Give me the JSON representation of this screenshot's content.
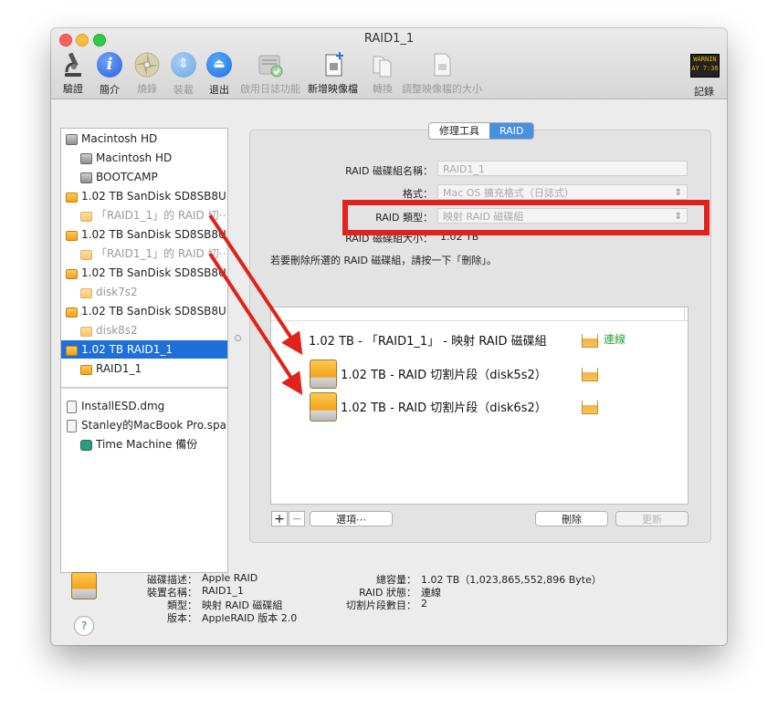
{
  "window": {
    "title": "RAID1_1"
  },
  "toolbar": {
    "items": [
      {
        "label": "驗證",
        "icon": "microscope-icon",
        "enabled": true
      },
      {
        "label": "簡介",
        "icon": "info-icon",
        "enabled": true
      },
      {
        "label": "燒錄",
        "icon": "burn-disc-icon",
        "enabled": false
      },
      {
        "label": "裝載",
        "icon": "mount-icon",
        "enabled": false
      },
      {
        "label": "退出",
        "icon": "eject-icon",
        "enabled": true
      },
      {
        "label": "啟用日誌功能",
        "icon": "journal-icon",
        "enabled": false
      },
      {
        "label": "新增映像檔",
        "icon": "new-image-icon",
        "enabled": true
      },
      {
        "label": "轉換",
        "icon": "convert-icon",
        "enabled": false
      },
      {
        "label": "調整映像檔的大小",
        "icon": "resize-image-icon",
        "enabled": false
      }
    ],
    "log": {
      "label": "記錄",
      "icon": "log-icon",
      "badge": "WARNIN\nAY 7:36"
    }
  },
  "sidebar": {
    "items": [
      {
        "label": "Macintosh HD",
        "icon": "hard-drive-icon",
        "level": 0,
        "dim": false,
        "selected": false
      },
      {
        "label": "Macintosh HD",
        "icon": "hard-drive-icon",
        "level": 1,
        "dim": false,
        "selected": false
      },
      {
        "label": "BOOTCAMP",
        "icon": "hard-drive-icon",
        "level": 1,
        "dim": false,
        "selected": false
      },
      {
        "label": "1.02 TB SanDisk SD8SB8U...",
        "icon": "external-drive-icon",
        "level": 0,
        "dim": false,
        "selected": false
      },
      {
        "label": "「RAID1_1」的 RAID 切⋯",
        "icon": "external-drive-icon",
        "level": 1,
        "dim": true,
        "selected": false
      },
      {
        "label": "1.02 TB SanDisk SD8SB8U...",
        "icon": "external-drive-icon",
        "level": 0,
        "dim": false,
        "selected": false
      },
      {
        "label": "「RAID1_1」的 RAID 切⋯",
        "icon": "external-drive-icon",
        "level": 1,
        "dim": true,
        "selected": false
      },
      {
        "label": "1.02 TB SanDisk SD8SB8U...",
        "icon": "external-drive-icon",
        "level": 0,
        "dim": false,
        "selected": false
      },
      {
        "label": "disk7s2",
        "icon": "external-drive-icon",
        "level": 1,
        "dim": true,
        "selected": false
      },
      {
        "label": "1.02 TB SanDisk SD8SB8U...",
        "icon": "external-drive-icon",
        "level": 0,
        "dim": false,
        "selected": false
      },
      {
        "label": "disk8s2",
        "icon": "external-drive-icon",
        "level": 1,
        "dim": true,
        "selected": false
      },
      {
        "label": "1.02 TB RAID1_1",
        "icon": "external-drive-icon",
        "level": 0,
        "dim": false,
        "selected": true
      },
      {
        "label": "RAID1_1",
        "icon": "external-drive-icon",
        "level": 1,
        "dim": false,
        "selected": false
      }
    ],
    "images": [
      {
        "label": "InstallESD.dmg",
        "icon": "disk-image-icon",
        "level": 0
      },
      {
        "label": "Stanley的MacBook Pro.spa...",
        "icon": "disk-image-icon",
        "level": 0
      },
      {
        "label": "Time Machine 備份",
        "icon": "time-machine-icon",
        "level": 1
      }
    ]
  },
  "tabs": {
    "repair": "修理工具",
    "raid": "RAID"
  },
  "raid_form": {
    "name_label": "RAID 磁碟組名稱：",
    "name_value": "RAID1_1",
    "format_label": "格式：",
    "format_value": "Mac OS 擴充格式（日誌式）",
    "type_label": "RAID 類型：",
    "type_value": "映射 RAID 磁碟組",
    "size_label": "RAID 磁碟組大小：",
    "size_value": "1.02 TB",
    "note": "若要刪除所選的 RAID 磁碟組，請按一下「刪除」。"
  },
  "raid_list": {
    "set": {
      "label": "1.02 TB - 「RAID1_1」 - 映射 RAID 磁碟組",
      "status": "連線"
    },
    "members": [
      {
        "label": "1.02 TB - RAID 切割片段（disk5s2）"
      },
      {
        "label": "1.02 TB - RAID 切割片段（disk6s2）"
      }
    ]
  },
  "buttons": {
    "add": "+",
    "remove": "−",
    "options": "選項⋯",
    "delete": "刪除",
    "update": "更新"
  },
  "info": {
    "desc_label": "磁碟描述：",
    "desc_value": "Apple RAID",
    "device_label": "裝置名稱：",
    "device_value": "RAID1_1",
    "type_label": "類型：",
    "type_value": "映射 RAID 磁碟組",
    "version_label": "版本：",
    "version_value": "AppleRAID 版本 2.0",
    "capacity_label": "總容量：",
    "capacity_value": "1.02 TB（1,023,865,552,896 Byte）",
    "status_label": "RAID 狀態：",
    "status_value": "連線",
    "slices_label": "切割片段數目：",
    "slices_value": "2",
    "help": "?"
  },
  "colors": {
    "selection": "#1e6fd9",
    "highlight_box": "#e0221b",
    "annotation_arrow": "#e0221b",
    "online": "#27a33a",
    "disk_orange": "#f3a21c"
  }
}
